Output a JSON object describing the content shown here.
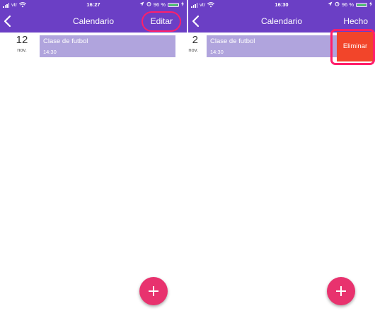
{
  "screens": [
    {
      "status": {
        "carrier": "vtr",
        "time": "16:27",
        "battery_pct": "96 %"
      },
      "nav": {
        "title": "Calendario",
        "action_label": "Editar"
      },
      "event": {
        "day": "12",
        "month": "nov.",
        "title": "Clase de futbol",
        "time": "14:30"
      }
    },
    {
      "status": {
        "carrier": "vtr",
        "time": "16:30",
        "battery_pct": "96 %"
      },
      "nav": {
        "title": "Calendario",
        "action_label": "Hecho"
      },
      "event": {
        "day": "2",
        "month": "nov.",
        "title": "Clase de futbol",
        "time": "14:30"
      },
      "row_action": {
        "delete_label": "Eliminar"
      }
    }
  ],
  "colors": {
    "header": "#6b3fc5",
    "event_card": "#b0a4dd",
    "delete": "#f2452a",
    "fab": "#e8326e",
    "highlight": "#ff1f6b",
    "battery": "#4cd964"
  },
  "icons": {
    "back": "chevron-left-icon",
    "add": "plus-icon",
    "wifi": "wifi-icon",
    "location": "location-arrow-icon",
    "alarm": "alarm-icon",
    "battery": "battery-icon",
    "charging": "bolt-icon"
  }
}
